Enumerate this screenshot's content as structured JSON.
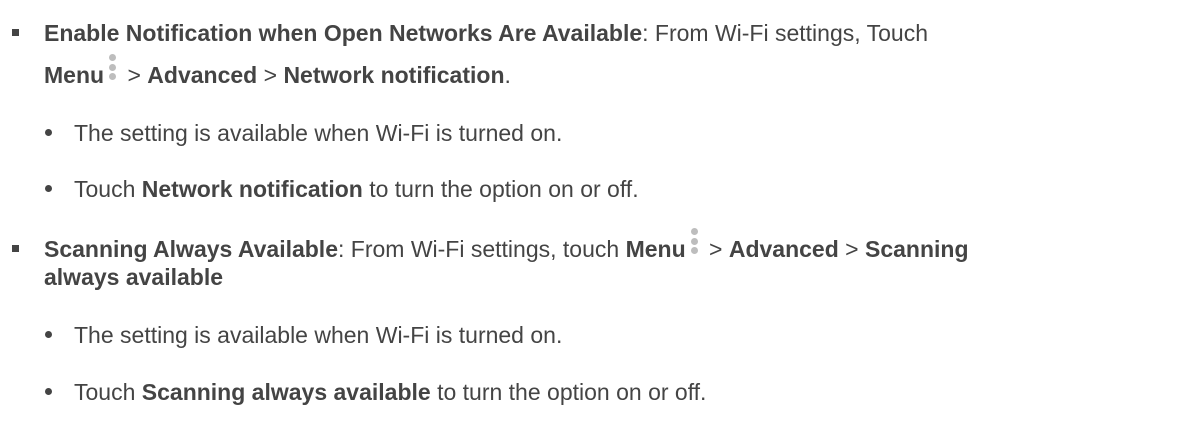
{
  "sections": [
    {
      "heading": "Enable Notification when Open Networks Are Available",
      "intro": ": From Wi-Fi settings, Touch",
      "menu": "Menu",
      "menu_icon": "three-dot-menu-icon",
      "sep1": " > ",
      "step1": "Advanced",
      "sep2": " > ",
      "step2": "Network notification",
      "tail": ".",
      "sub_items": [
        {
          "text": "The setting is available when Wi-Fi is turned on."
        },
        {
          "prefix": "Touch ",
          "bold": "Network notification",
          "suffix": " to turn the option on or off."
        }
      ]
    },
    {
      "heading": "Scanning Always Available",
      "intro": ": From Wi-Fi settings, touch ",
      "menu": "Menu",
      "menu_icon": "three-dot-menu-icon",
      "sep1": " > ",
      "step1": "Advanced",
      "sep2": " > ",
      "step2a": "Scanning",
      "step2b": "always available",
      "sub_items": [
        {
          "text": "The setting is available when Wi-Fi is turned on."
        },
        {
          "prefix": "Touch ",
          "bold": "Scanning always available",
          "suffix": " to turn the option on or off."
        }
      ]
    }
  ],
  "colors": {
    "text": "#444444",
    "menu_icon": "#bdbdbd"
  }
}
